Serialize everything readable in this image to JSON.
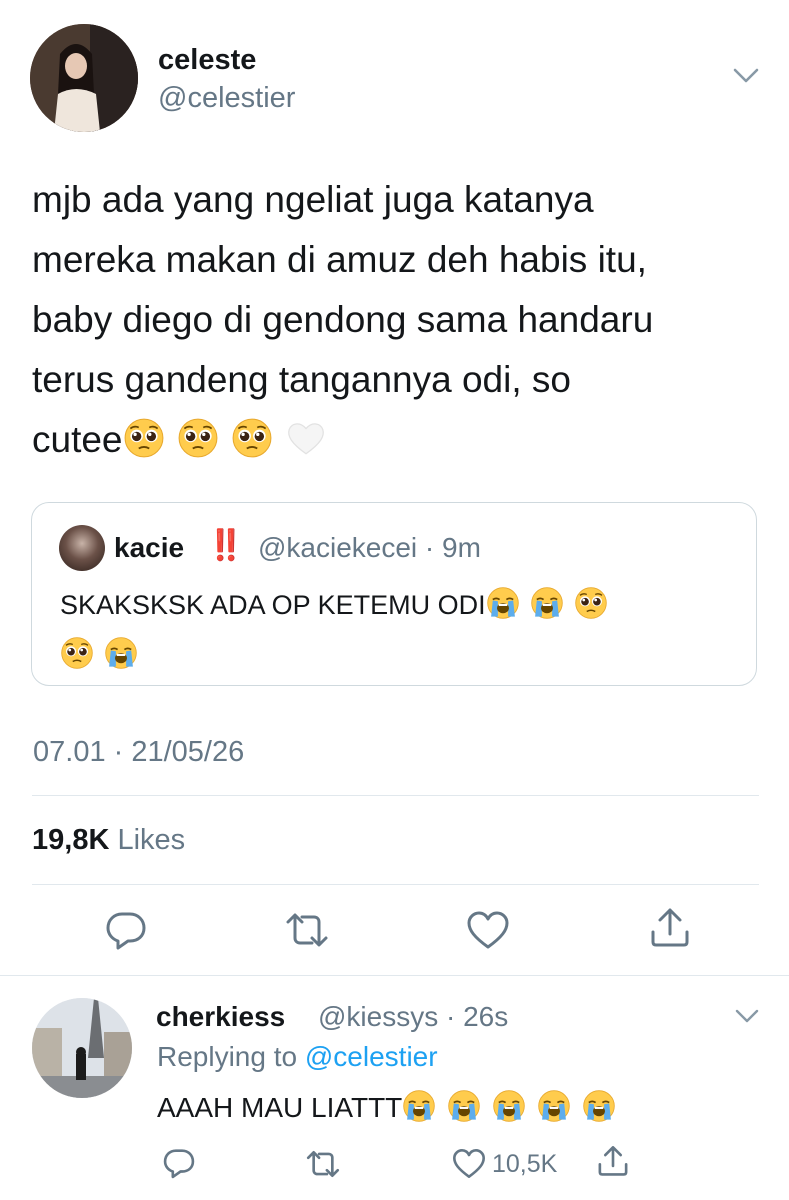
{
  "tweet": {
    "display_name": "celeste",
    "handle": "@celestier",
    "text_lines": [
      "mjb ada yang ngeliat juga katanya",
      "mereka makan di amuz deh habis itu,",
      "baby diego di gendong sama handaru",
      "terus gandeng tangannya odi, so",
      "cutee"
    ],
    "text_trailing_emoji": [
      "pleading-face",
      "pleading-face",
      "pleading-face",
      "white-heart"
    ],
    "timestamp": "07.01 · 21/05/26",
    "likes_count": "19,8K",
    "likes_label": "Likes"
  },
  "quoted": {
    "display_name": "kacie",
    "badge": "‼️",
    "meta": "@kaciekecei · 9m",
    "text": "SKAKSKSK ADA OP KETEMU ODI",
    "emoji_line1": [
      "loudly-crying-face",
      "loudly-crying-face",
      "pleading-face"
    ],
    "emoji_line2": [
      "pleading-face",
      "loudly-crying-face"
    ]
  },
  "actions": [
    "reply-icon",
    "retweet-icon",
    "like-icon",
    "share-icon"
  ],
  "reply": {
    "display_name": "cherkiess",
    "meta": "@kiessys · 26s",
    "replying_prefix": "Replying to",
    "replying_handle": "@celestier",
    "text": "AAAH MAU LIATTT",
    "emoji": [
      "loudly-crying-face",
      "loudly-crying-face",
      "loudly-crying-face",
      "loudly-crying-face",
      "loudly-crying-face"
    ],
    "like_count": "10,5K"
  },
  "colors": {
    "text": "#14171a",
    "secondary": "#657786",
    "link": "#1da1f2",
    "border": "#cfd9de",
    "emoji_face": "#ffcc4d"
  }
}
